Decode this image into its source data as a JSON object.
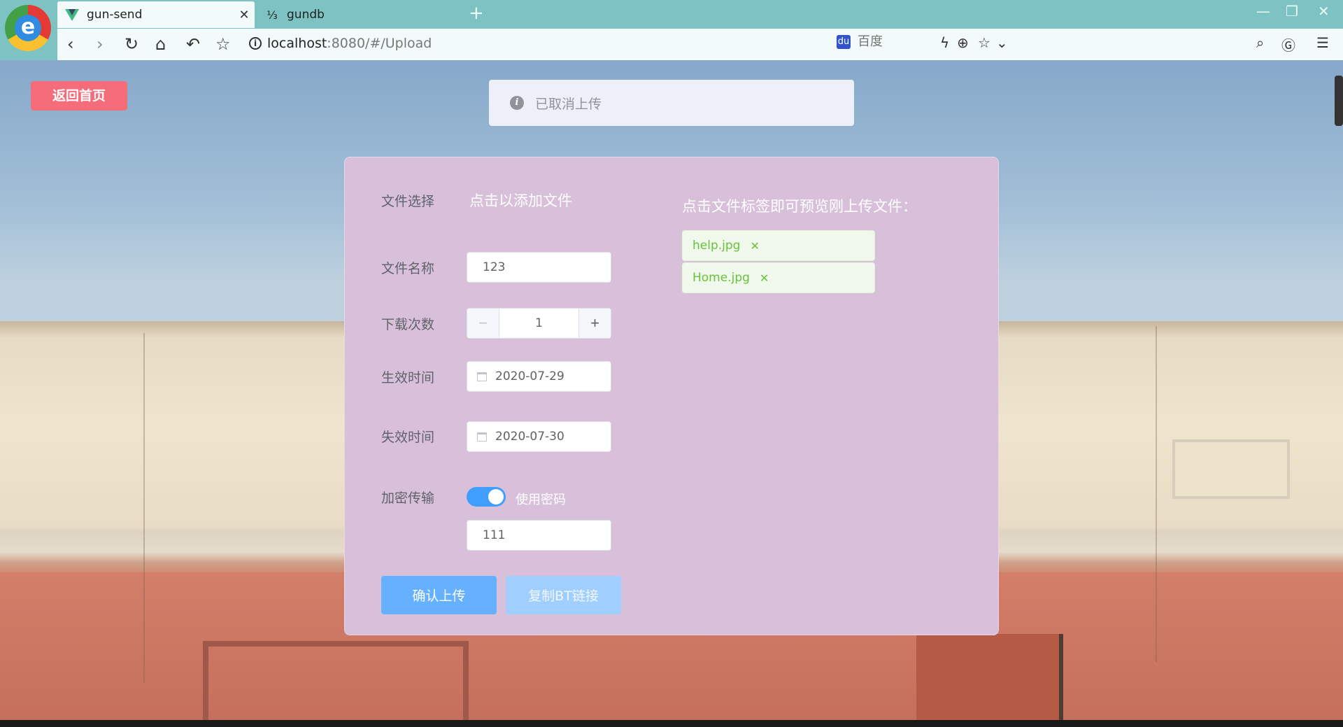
{
  "browser": {
    "tabs": [
      {
        "title": "gun-send",
        "active": true
      },
      {
        "title": "gundb",
        "active": false
      }
    ],
    "url_host": "localhost",
    "url_rest": ":8080/#/Upload",
    "search_placeholder": "百度"
  },
  "page": {
    "home_button": "返回首页",
    "message": "已取消上传"
  },
  "form": {
    "file_select_label": "文件选择",
    "file_select_action": "点击以添加文件",
    "file_name_label": "文件名称",
    "file_name_value": "123",
    "download_count_label": "下载次数",
    "download_count_value": "1",
    "start_time_label": "生效时间",
    "start_time_value": "2020-07-29",
    "end_time_label": "失效时间",
    "end_time_value": "2020-07-30",
    "encrypt_label": "加密传输",
    "encrypt_toggle_label": "使用密码",
    "encrypt_on": true,
    "password_value": "111",
    "confirm_button": "确认上传",
    "copy_button": "复制BT链接"
  },
  "preview": {
    "title": "点击文件标签即可预览刚上传文件：",
    "files": [
      "help.jpg",
      "Home.jpg"
    ]
  },
  "colors": {
    "accent": "#409eff",
    "danger": "#f56c7a",
    "success": "#67c23a",
    "card": "#d8c0da"
  }
}
